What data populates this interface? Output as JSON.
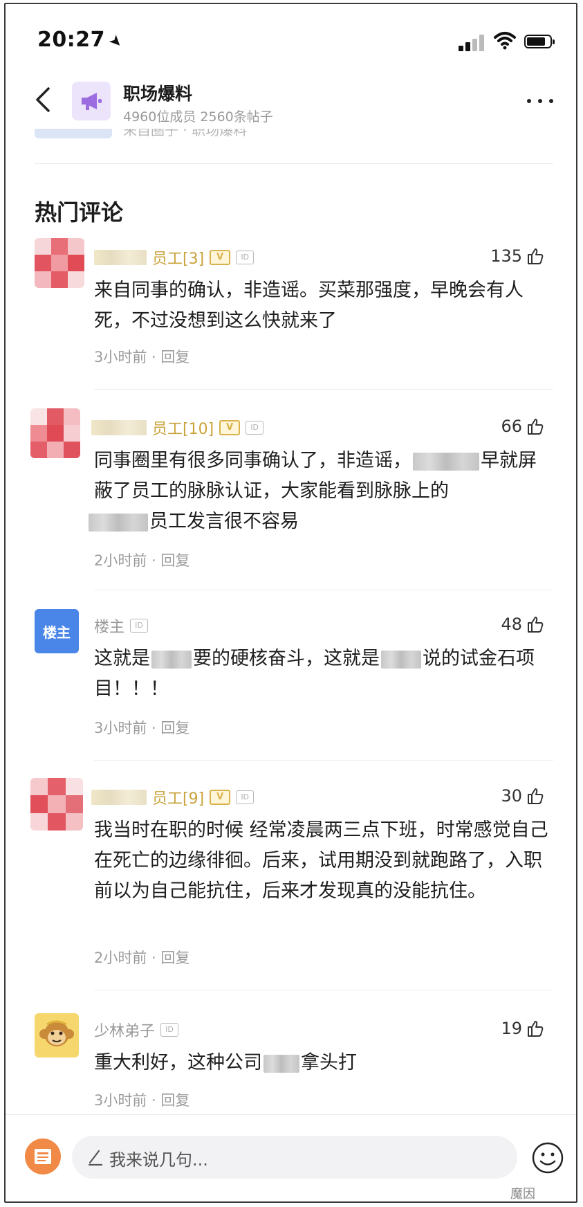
{
  "status_bar": {
    "time": "20:27"
  },
  "header": {
    "title": "职场爆料",
    "subtitle": "4960位成员 2560条帖子"
  },
  "prev": {
    "text": "来自圈子 · 职场爆料"
  },
  "section": {
    "title": "热门评论"
  },
  "comments": [
    {
      "name": "员工[3]",
      "likes": "135",
      "text_a": "来自同事的确认，非造谣。买菜那强度，早晚会有人死，不过没想到这么快就来了",
      "time": "3小时前",
      "reply": "回复"
    },
    {
      "name": "员工[10]",
      "likes": "66",
      "text_a": "同事圈里有很多同事确认了，非造谣，",
      "text_b": "早就屏蔽了员工的脉脉认证，大家能看到脉脉上的",
      "text_c": "员工发言很不容易",
      "time": "2小时前",
      "reply": "回复"
    },
    {
      "name": "楼主",
      "avatar_label": "楼主",
      "likes": "48",
      "text_a": "这就是",
      "text_b": "要的硬核奋斗，这就是",
      "text_c": "说的试金石项目！！！",
      "time": "3小时前",
      "reply": "回复"
    },
    {
      "name": "员工[9]",
      "likes": "30",
      "text_a": "我当时在职的时候 经常凌晨两三点下班，时常感觉自己在死亡的边缘徘徊。后来，试用期没到就跑路了，入职前以为自己能抗住，后来才发现真的没能抗住。",
      "time": "2小时前",
      "reply": "回复"
    },
    {
      "name": "少林弟子",
      "likes": "19",
      "text_a": "重大利好，这种公司",
      "text_b": "拿头打",
      "time": "3小时前",
      "reply": "回复"
    }
  ],
  "input": {
    "placeholder": "我来说几句..."
  },
  "watermark": "魔因",
  "badges": {
    "verified": "V",
    "id": "ID"
  }
}
